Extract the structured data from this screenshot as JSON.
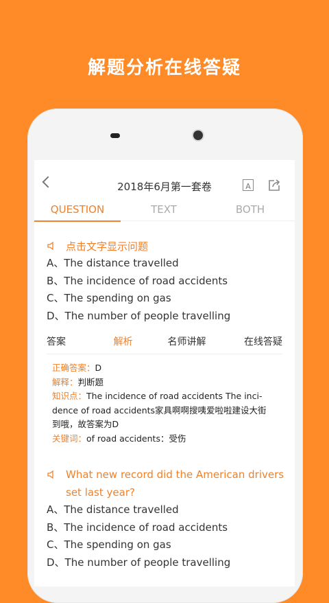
{
  "banner": {
    "text": "解题分析在线答疑"
  },
  "header": {
    "title": "2018年6月第一套卷",
    "font_icon": "A"
  },
  "tabs": [
    {
      "label": "QUESTION",
      "active": true
    },
    {
      "label": "TEXT",
      "active": false
    },
    {
      "label": "BOTH",
      "active": false
    }
  ],
  "question1": {
    "prompt": "点击文字显示问题",
    "options": [
      "A、The distance travelled",
      "B、The incidence of road accidents",
      "C、The spending on gas",
      "D、The number of people travelling"
    ]
  },
  "subtabs": [
    {
      "label": "答案",
      "active": false
    },
    {
      "label": "解析",
      "active": true
    },
    {
      "label": "名师讲解",
      "active": false
    },
    {
      "label": "在线答疑",
      "active": false
    }
  ],
  "analysis": {
    "answer_label": "正确答案：",
    "answer_value": "D",
    "explain_label": "解释：",
    "explain_value": "判断题",
    "point_label": "知识点：",
    "point_value_line1": "The incidence of road accidents The inci-",
    "point_value_line2": "dence of road accidents家具啊啊搜咦爱啦啦建设大街",
    "point_value_line3": "到哦，故答案为D",
    "keyword_label": "关键词：",
    "keyword_value": "of road accidents：受伤"
  },
  "question2": {
    "prompt_line1": "What new record did the American drivers",
    "prompt_line2": "set last year?",
    "options": [
      "A、The distance travelled",
      "B、The incidence of road accidents",
      "C、The spending on gas",
      "D、The number of people travelling"
    ]
  },
  "colors": {
    "accent": "#F0812A",
    "background": "#FF8A28"
  }
}
